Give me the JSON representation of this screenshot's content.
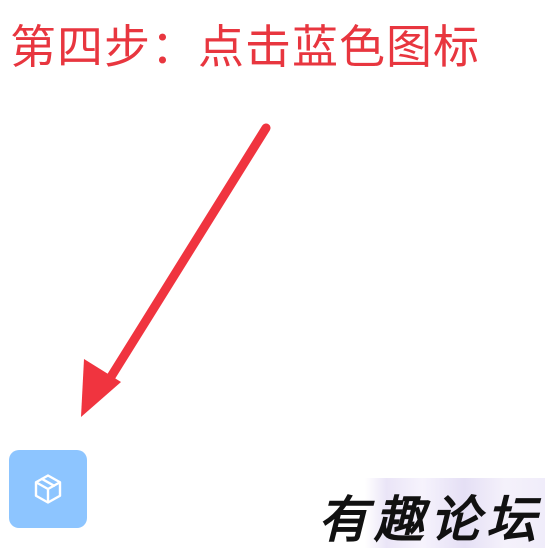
{
  "instruction": {
    "text": "第四步：点击蓝色图标",
    "color": "#e8363f"
  },
  "arrow": {
    "icon": "arrow-down-left-icon",
    "color": "#f0343f"
  },
  "app_icon": {
    "icon": "cube-box-icon",
    "background": "#8dc5ff",
    "glyph_color": "#ffffff"
  },
  "watermark": {
    "text": "有趣论坛"
  }
}
